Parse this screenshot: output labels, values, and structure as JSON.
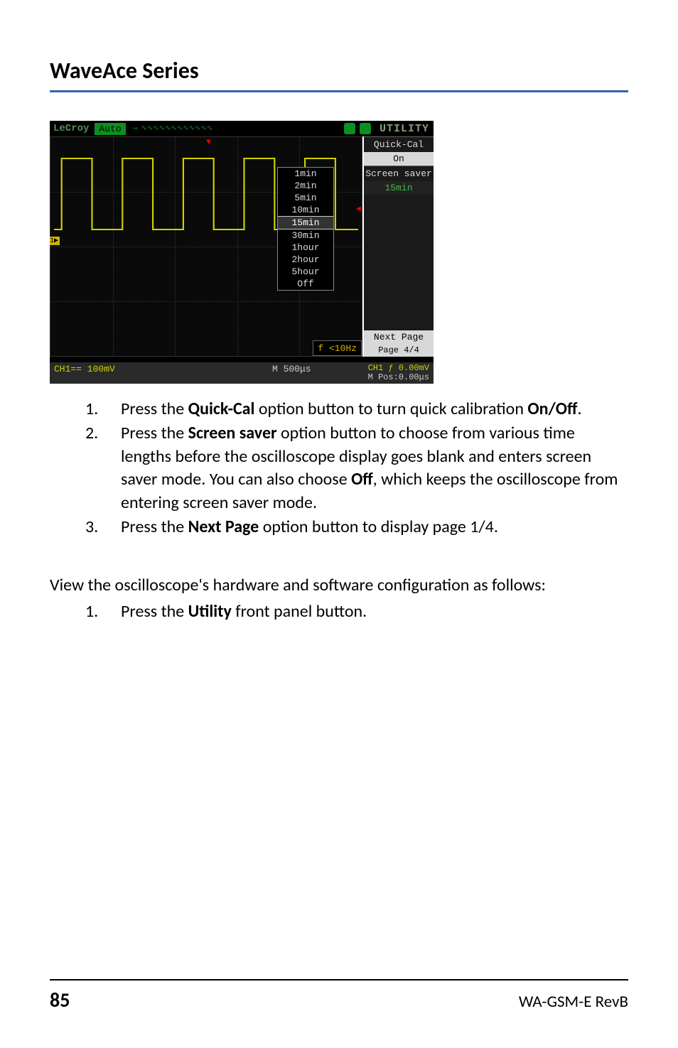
{
  "header": {
    "title": "WaveAce Series"
  },
  "scope": {
    "brand": "LeCroy",
    "auto_label": "Auto",
    "utility_label": "UTILITY",
    "menu": {
      "quick_cal_label": "Quick-Cal",
      "quick_cal_value": "On",
      "screen_saver_label": "Screen saver",
      "screen_saver_value": "15min",
      "next_page_label": "Next Page",
      "page_indicator": "Page 4/4"
    },
    "popup_options": [
      "1min",
      "2min",
      "5min",
      "10min",
      "15min",
      "30min",
      "1hour",
      "2hour",
      "5hour",
      "Off"
    ],
    "popup_selected": "15min",
    "freq_label": "f <10Hz",
    "status": {
      "ch1": "CH1== 100mV",
      "m": "M 500μs",
      "ch1f": "CH1 ƒ 0.00mV",
      "mpos": "M Pos:0.00μs"
    }
  },
  "instructions": [
    {
      "num": "1.",
      "pre": "Press the ",
      "bold1": "Quick-Cal",
      "mid": " option button to turn quick calibration ",
      "bold2": "On/Off",
      "post": "."
    },
    {
      "num": "2.",
      "pre": "Press the ",
      "bold1": "Screen saver",
      "mid": " option button to choose from various time lengths before the oscilloscope display goes blank and enters screen saver mode. You can also choose ",
      "bold2": "Off",
      "post": ", which keeps the oscilloscope from entering screen saver mode."
    },
    {
      "num": "3.",
      "pre": "Press the ",
      "bold1": "Next Page",
      "mid": " option button to display page 1/4.",
      "bold2": "",
      "post": ""
    }
  ],
  "body_para_pre": "View the oscilloscope's hardware and software configuration as follows:",
  "sub_list": {
    "num": "1.",
    "pre": "Press the ",
    "bold1": "Utility",
    "post": " front panel button."
  },
  "footer": {
    "page_num": "85",
    "doc_id": "WA-GSM-E RevB"
  }
}
